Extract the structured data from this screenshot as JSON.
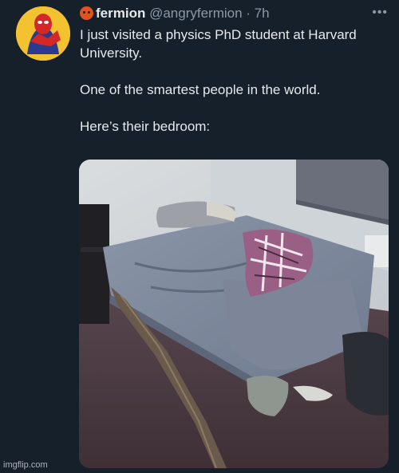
{
  "tweet": {
    "name": "fermion",
    "handle": "@angryfermion",
    "separator": " · ",
    "time": "7h",
    "more_icon": "more-icon",
    "paragraphs": [
      "I just visited a physics PhD student at Harvard University.",
      "One of the smartest people in the world.",
      "Here’s their bedroom:"
    ]
  },
  "watermark": "imgflip.com",
  "colors": {
    "background": "#15202b",
    "text": "#e7e9ea",
    "secondary": "#8b98a5"
  }
}
